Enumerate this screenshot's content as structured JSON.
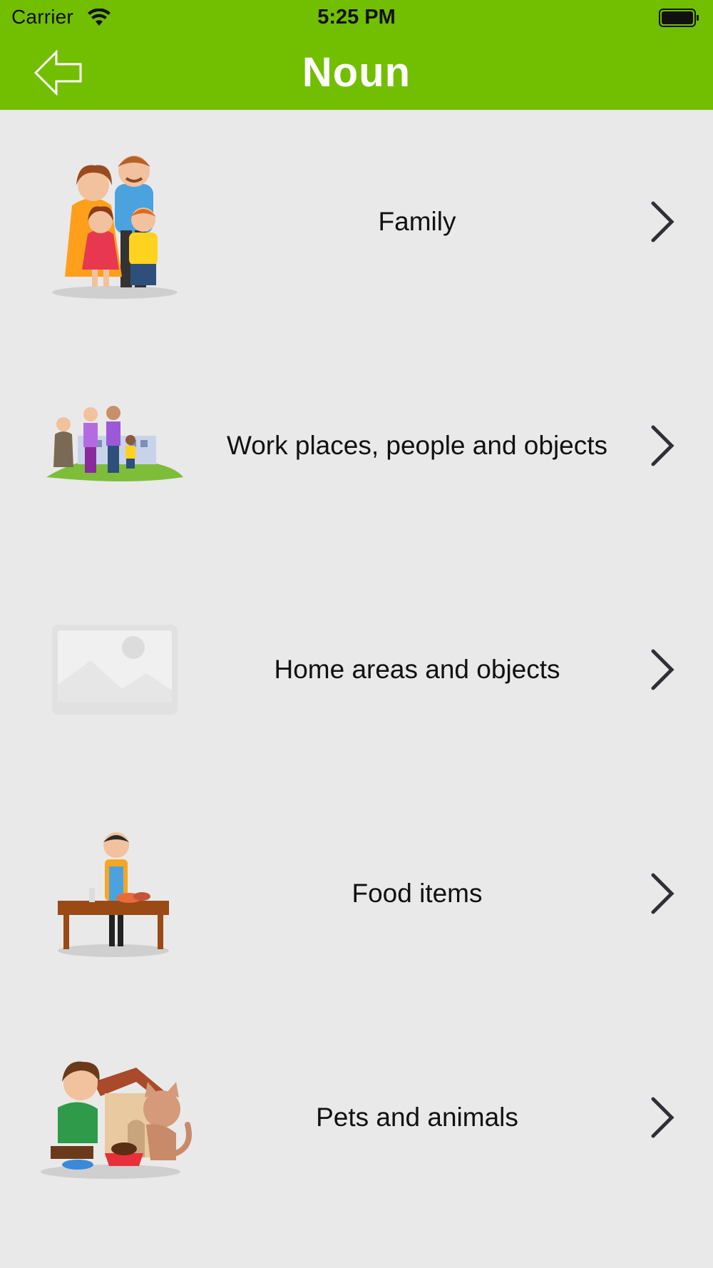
{
  "status_bar": {
    "carrier": "Carrier",
    "time": "5:25 PM",
    "wifi_icon": "wifi-icon",
    "battery_icon": "battery-icon"
  },
  "header": {
    "title": "Noun",
    "back_icon": "back-arrow-icon"
  },
  "colors": {
    "header_bg": "#72be00",
    "list_bg": "#e9e9e9",
    "text": "#111111",
    "chevron": "#2f2f38"
  },
  "categories": [
    {
      "label": "Family",
      "icon": "family-illustration"
    },
    {
      "label": "Work places, people and objects",
      "icon": "workplace-people-illustration"
    },
    {
      "label": "Home areas and objects",
      "icon": "image-placeholder"
    },
    {
      "label": "Food items",
      "icon": "food-vendor-illustration"
    },
    {
      "label": "Pets and animals",
      "icon": "pets-illustration"
    }
  ]
}
